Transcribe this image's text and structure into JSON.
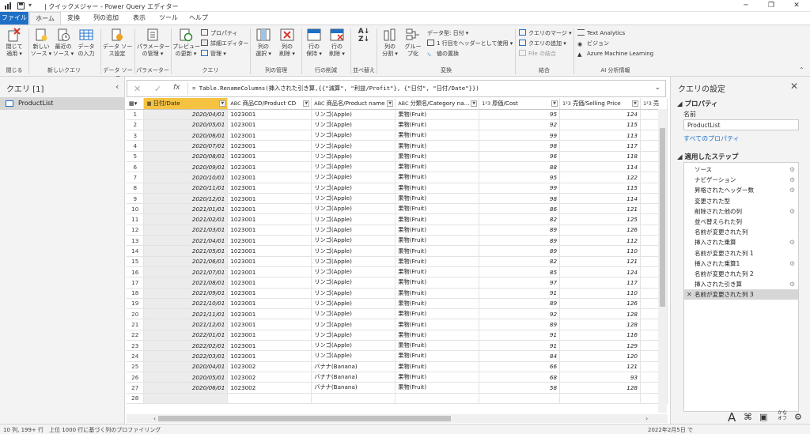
{
  "titlebar": {
    "title": "| クイックメジャー - Power Query エディター"
  },
  "tabs": [
    "ファイル",
    "ホーム",
    "変換",
    "列の追加",
    "表示",
    "ツール",
    "ヘルプ"
  ],
  "ribbon": {
    "close_apply": "閉じて\n適用 ▾",
    "new_source": "新しい\nソース ▾",
    "recent_sources": "最近の\nソース ▾",
    "enter_data": "データ\nの入力",
    "data_source_settings": "データ ソー\nス設定",
    "manage_params": "パラメーター\nの管理 ▾",
    "preview_refresh": "プレビュー\nの更新 ▾",
    "properties": "プロパティ",
    "advanced_editor": "詳細エディター",
    "manage": "管理 ▾",
    "choose_columns": "列の\n選択 ▾",
    "remove_columns": "列の\n削除 ▾",
    "keep_rows": "行の\n保持 ▾",
    "remove_rows": "行の\n削除 ▾",
    "split_column": "列の\n分割 ▾",
    "group_by": "グルー\nプ化",
    "data_type": "データ型: 日付 ▾",
    "first_row_header": "1 行目をヘッダーとして使用 ▾",
    "replace_values": "値の置換",
    "merge_queries": "クエリのマージ ▾",
    "append_queries": "クエリの追加 ▾",
    "combine_files": "File の結合",
    "text_analytics": "Text Analytics",
    "vision": "ビジョン",
    "azure_ml": "Azure Machine Learning",
    "groups": [
      "閉じる",
      "新しいクエリ",
      "データ ソース",
      "パラメーター",
      "クエリ",
      "列の管理",
      "行の削減",
      "並べ替え",
      "変換",
      "結合",
      "AI 分析情報"
    ]
  },
  "left_pane": {
    "header": "クエリ [1]",
    "collapse": "‹",
    "query": "ProductList"
  },
  "formula": {
    "cancel": "✕",
    "commit": "✓",
    "fx": "fx",
    "text": "= Table.RenameColumns(挿入された引き算,{{\"減算\", \"利益/Profit\"}, {\"日付\", \"日付/Date\"}})",
    "expand": "⌄"
  },
  "columns": [
    {
      "type": "▦",
      "name": "日付/Date"
    },
    {
      "type": "ABC",
      "name": "商品CD/Product CD"
    },
    {
      "type": "ABC",
      "name": "商品名/Product name"
    },
    {
      "type": "ABC",
      "name": "分類名/Category na..."
    },
    {
      "type": "1²3",
      "name": "原価/Cost"
    },
    {
      "type": "1²3",
      "name": "売価/Selling Price"
    },
    {
      "type": "1²3",
      "name": "売"
    }
  ],
  "rows": [
    [
      "1",
      "2020/04/01",
      "1023001",
      "リンゴ(Apple)",
      "果物(Fruit)",
      "95",
      "124"
    ],
    [
      "2",
      "2020/05/01",
      "1023001",
      "リンゴ(Apple)",
      "果物(Fruit)",
      "92",
      "115"
    ],
    [
      "3",
      "2020/06/01",
      "1023001",
      "リンゴ(Apple)",
      "果物(Fruit)",
      "99",
      "113"
    ],
    [
      "4",
      "2020/07/01",
      "1023001",
      "リンゴ(Apple)",
      "果物(Fruit)",
      "98",
      "117"
    ],
    [
      "5",
      "2020/08/01",
      "1023001",
      "リンゴ(Apple)",
      "果物(Fruit)",
      "96",
      "118"
    ],
    [
      "6",
      "2020/09/01",
      "1023001",
      "リンゴ(Apple)",
      "果物(Fruit)",
      "88",
      "114"
    ],
    [
      "7",
      "2020/10/01",
      "1023001",
      "リンゴ(Apple)",
      "果物(Fruit)",
      "95",
      "122"
    ],
    [
      "8",
      "2020/11/01",
      "1023001",
      "リンゴ(Apple)",
      "果物(Fruit)",
      "99",
      "115"
    ],
    [
      "9",
      "2020/12/01",
      "1023001",
      "リンゴ(Apple)",
      "果物(Fruit)",
      "98",
      "114"
    ],
    [
      "10",
      "2021/01/01",
      "1023001",
      "リンゴ(Apple)",
      "果物(Fruit)",
      "86",
      "121"
    ],
    [
      "11",
      "2021/02/01",
      "1023001",
      "リンゴ(Apple)",
      "果物(Fruit)",
      "82",
      "125"
    ],
    [
      "12",
      "2021/03/01",
      "1023001",
      "リンゴ(Apple)",
      "果物(Fruit)",
      "89",
      "126"
    ],
    [
      "13",
      "2021/04/01",
      "1023001",
      "リンゴ(Apple)",
      "果物(Fruit)",
      "89",
      "112"
    ],
    [
      "14",
      "2021/05/01",
      "1023001",
      "リンゴ(Apple)",
      "果物(Fruit)",
      "89",
      "110"
    ],
    [
      "15",
      "2021/06/01",
      "1023001",
      "リンゴ(Apple)",
      "果物(Fruit)",
      "82",
      "121"
    ],
    [
      "16",
      "2021/07/01",
      "1023001",
      "リンゴ(Apple)",
      "果物(Fruit)",
      "85",
      "124"
    ],
    [
      "17",
      "2021/08/01",
      "1023001",
      "リンゴ(Apple)",
      "果物(Fruit)",
      "97",
      "117"
    ],
    [
      "18",
      "2021/09/01",
      "1023001",
      "リンゴ(Apple)",
      "果物(Fruit)",
      "91",
      "110"
    ],
    [
      "19",
      "2021/10/01",
      "1023001",
      "リンゴ(Apple)",
      "果物(Fruit)",
      "89",
      "126"
    ],
    [
      "20",
      "2021/11/01",
      "1023001",
      "リンゴ(Apple)",
      "果物(Fruit)",
      "92",
      "128"
    ],
    [
      "21",
      "2021/12/01",
      "1023001",
      "リンゴ(Apple)",
      "果物(Fruit)",
      "89",
      "128"
    ],
    [
      "22",
      "2022/01/01",
      "1023001",
      "リンゴ(Apple)",
      "果物(Fruit)",
      "91",
      "116"
    ],
    [
      "23",
      "2022/02/01",
      "1023001",
      "リンゴ(Apple)",
      "果物(Fruit)",
      "91",
      "129"
    ],
    [
      "24",
      "2022/03/01",
      "1023001",
      "リンゴ(Apple)",
      "果物(Fruit)",
      "84",
      "120"
    ],
    [
      "25",
      "2020/04/01",
      "1023002",
      "バナナ(Banana)",
      "果物(Fruit)",
      "66",
      "121"
    ],
    [
      "26",
      "2020/05/01",
      "1023002",
      "バナナ(Banana)",
      "果物(Fruit)",
      "68",
      "93"
    ],
    [
      "27",
      "2020/06/01",
      "1023002",
      "バナナ(Banana)",
      "果物(Fruit)",
      "58",
      "128"
    ],
    [
      "28",
      "",
      "",
      "",
      "",
      "",
      ""
    ]
  ],
  "right_pane": {
    "header": "クエリの設定",
    "close": "✕",
    "properties_section": "◢ プロパティ",
    "name_label": "名前",
    "name_value": "ProductList",
    "all_properties": "すべてのプロパティ",
    "steps_section": "◢ 適用したステップ",
    "steps": [
      {
        "label": "ソース",
        "gear": true
      },
      {
        "label": "ナビゲーション",
        "gear": true
      },
      {
        "label": "昇格されたヘッダー数",
        "gear": true
      },
      {
        "label": "変更された型",
        "gear": false
      },
      {
        "label": "削除された他の列",
        "gear": true
      },
      {
        "label": "並べ替えられた列",
        "gear": false
      },
      {
        "label": "名前が変更された列",
        "gear": false
      },
      {
        "label": "挿入された乗算",
        "gear": true
      },
      {
        "label": "名前が変更された列 1",
        "gear": false
      },
      {
        "label": "挿入された乗算1",
        "gear": true
      },
      {
        "label": "名前が変更された列 2",
        "gear": false
      },
      {
        "label": "挿入された引き算",
        "gear": true
      },
      {
        "label": "名前が変更された列 3",
        "gear": false,
        "active": true
      }
    ]
  },
  "status": {
    "columns_rows": "10 列, 199+ 行",
    "profiling": "上位 1000 行に基づく列のプロファイリング",
    "date": "2022年2月5日 で",
    "kana": "かな\nオフ"
  },
  "colors": {
    "file_tab": "#1f6fc5",
    "selected_header": "#f5c242",
    "pane_bg": "#f3f3f3",
    "accent": "#1f6fc5"
  }
}
